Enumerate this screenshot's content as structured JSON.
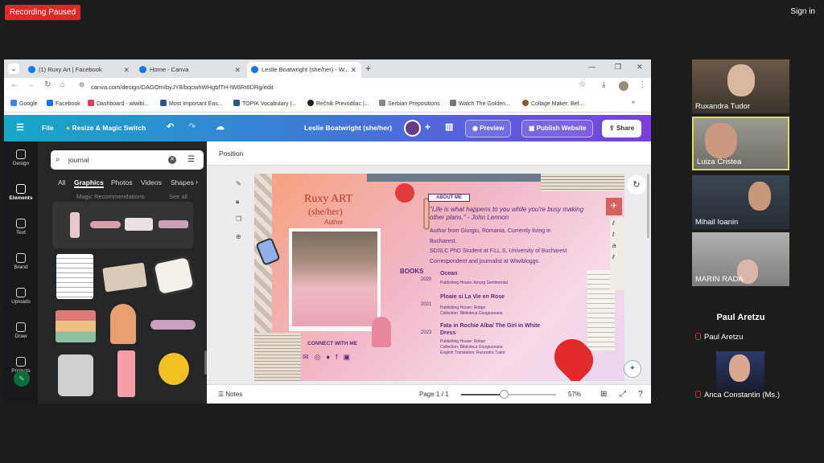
{
  "zoom": {
    "recording_label": "Recording Paused",
    "signin_label": "Sign in"
  },
  "browser": {
    "tabs": [
      {
        "label": "(1) Ruxy Art | Facebook",
        "color": "#1877f2"
      },
      {
        "label": "Home - Canva",
        "color": "#1a73e8"
      },
      {
        "label": "Leslie Boatwright (she/her) - W...",
        "color": "#1a73e8"
      }
    ],
    "url": "canva.com/design/DAGOmIbyJY8/bqcwhWHgbfTH-lW6Rt6DRg/edit",
    "bookmarks": [
      {
        "label": "Google",
        "color": "#4285f4"
      },
      {
        "label": "Facebook",
        "color": "#1877f2"
      },
      {
        "label": "Dashboard - wiwibi...",
        "color": "#e23b5a"
      },
      {
        "label": "Most Important Eas...",
        "color": "#2b5797"
      },
      {
        "label": "TOPIK Vocabulary |...",
        "color": "#2b5797"
      },
      {
        "label": "Rečnik Prevodilac |...",
        "color": "#222222"
      },
      {
        "label": "Serbian Prepositions",
        "color": "#888888"
      },
      {
        "label": "Watch The Golden...",
        "color": "#777777"
      },
      {
        "label": "Collage Maker: Bef...",
        "color": "#8b5a2b"
      }
    ]
  },
  "canva_header": {
    "file": "File",
    "resize": "Resize & Magic Switch",
    "title": "Leslie Boatwright (she/her)",
    "preview": "Preview",
    "publish": "Publish Website",
    "share": "Share"
  },
  "rail": [
    "Design",
    "Elements",
    "Text",
    "Brand",
    "Uploads",
    "Draw",
    "Projects"
  ],
  "panel": {
    "search_value": "journal",
    "tabs": [
      "All",
      "Graphics",
      "Photos",
      "Videos",
      "Shapes"
    ],
    "section_label": "Magic Recommendations",
    "see_all": "See all"
  },
  "workspace": {
    "position_label": "Position",
    "notes_label": "Notes",
    "page_label": "Page 1 / 1",
    "zoom_level": "57%",
    "zoom_fraction": 0.45
  },
  "design": {
    "name": "Ruxy ART",
    "pronouns": "(she/her)",
    "role": "Author",
    "connect": "CONNECT WITH ME",
    "about_label": "ABOUT ME",
    "quote": "\"Life is what happens to you while you're busy making other plans.\" - John Lennon",
    "bio_lines": [
      "Author from Giurgiu, Romania. Currently living in",
      "Bucharest.",
      "SDSLC PhD Student at F.LL.S, University of Bucharest",
      "Correspondent and journalist at Wiwibloggs."
    ],
    "books_label": "BOOKS",
    "books": [
      {
        "year": "2020",
        "title": "Ocean",
        "details": [
          "Publishing House: Amurg Sentimental"
        ]
      },
      {
        "year": "2021",
        "title": "Ploaie si La Vie en Rose",
        "details": [
          "Publishing House: Rotipo",
          "Collection: Biblioteca Giurgiuveana"
        ]
      },
      {
        "year": "2023",
        "title": "Fata in Rochie Alba/ The Girl in White Dress",
        "details": [
          "Publishing House: Rotipo",
          "Collection: Biblioteca Giurgiuveana",
          "English Translation: Ruxandra Tudor"
        ]
      }
    ]
  },
  "participants": [
    {
      "name": "Ruxandra Tudor",
      "muted": false,
      "active": false,
      "bg": "#4a4038"
    },
    {
      "name": "Luiza Cristea",
      "muted": false,
      "active": true,
      "bg": "#7a7a72"
    },
    {
      "name": "Mihail Ioanin",
      "muted": false,
      "active": false,
      "bg": "#303840"
    },
    {
      "name": "MARIN RADA",
      "muted": false,
      "active": false,
      "bg": "#8a8a88"
    },
    {
      "name": "Paul Aretzu",
      "muted": true,
      "active": false,
      "bg": "#1c1c1c",
      "label_big": "Paul Aretzu"
    },
    {
      "name": "Anca Constantin (Ms.)",
      "muted": true,
      "active": false,
      "bg": "#2a2a3a"
    }
  ],
  "colors": {
    "canva_gradient_start": "#14a8c8",
    "canva_gradient_end": "#7a3fe0",
    "zoom_rec": "#e02828",
    "active_speaker": "#d8e04a"
  }
}
